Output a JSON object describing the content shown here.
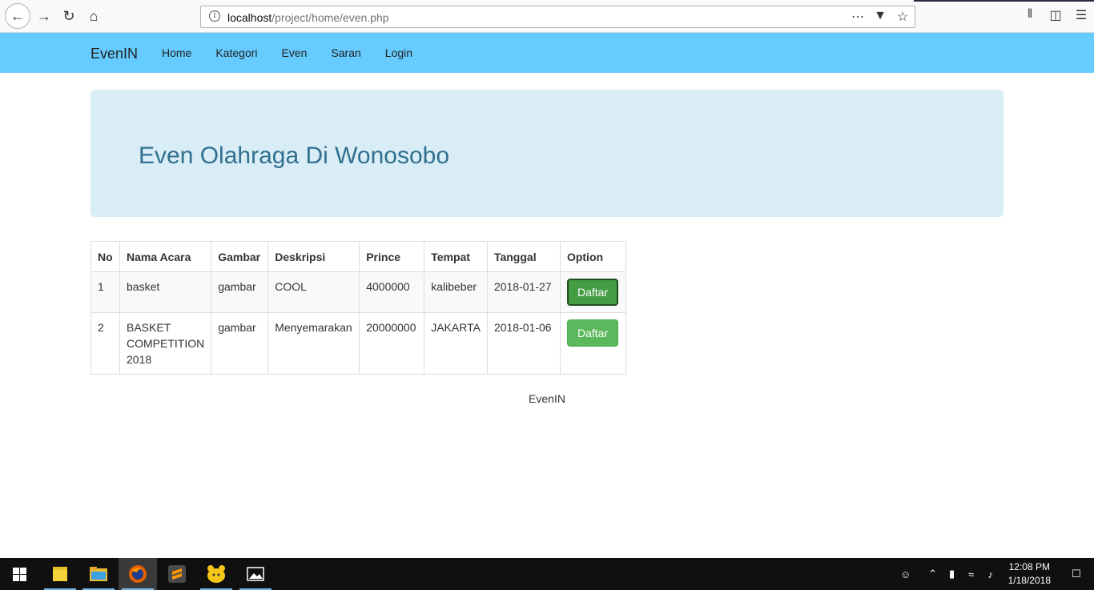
{
  "browser": {
    "url_host": "localhost",
    "url_path": "/project/home/even.php",
    "icons": [
      "back-icon",
      "forward-icon",
      "reload-icon",
      "home-icon",
      "page-actions-icon",
      "pocket-icon",
      "bookmark-star-icon",
      "library-icon",
      "sidebar-icon",
      "menu-icon"
    ]
  },
  "navbar": {
    "brand": "EvenIN",
    "items": [
      "Home",
      "Kategori",
      "Even",
      "Saran",
      "Login"
    ],
    "color": "#66ccff"
  },
  "jumbotron": {
    "title": "Even Olahraga Di Wonosobo"
  },
  "table": {
    "headers": [
      "No",
      "Nama Acara",
      "Gambar",
      "Deskripsi",
      "Prince",
      "Tempat",
      "Tanggal",
      "Option"
    ],
    "rows": [
      {
        "no": "1",
        "nama": "basket",
        "gambar": "gambar",
        "deskripsi": "COOL",
        "prince": "4000000",
        "tempat": "kalibeber",
        "tanggal": "2018-01-27",
        "option": "Daftar"
      },
      {
        "no": "2",
        "nama": "BASKET COMPETITION 2018",
        "gambar": "gambar",
        "deskripsi": "Menyemarakan",
        "prince": "20000000",
        "tempat": "JAKARTA",
        "tanggal": "2018-01-06",
        "option": "Daftar"
      }
    ]
  },
  "footer": {
    "text": "EvenIN"
  },
  "taskbar": {
    "time": "12:08 PM",
    "date": "1/18/2018",
    "apps": [
      "start-icon",
      "sticky-notes-icon",
      "file-explorer-icon",
      "firefox-icon",
      "sublime-text-icon",
      "app-icon",
      "photos-icon"
    ]
  }
}
